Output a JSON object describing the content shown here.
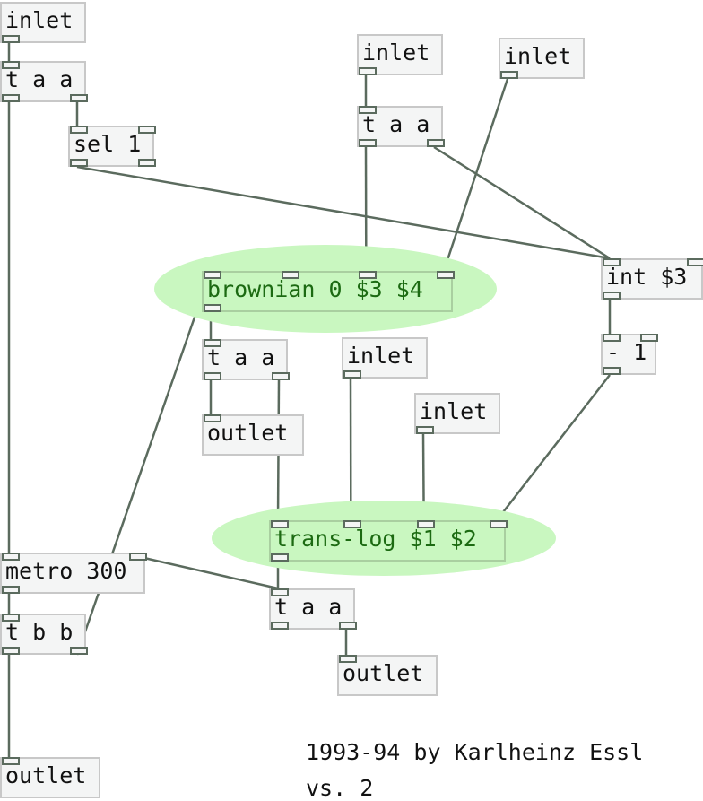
{
  "objects": [
    {
      "id": "inlet-a",
      "name": "inlet-object-1",
      "text": "inlet"
    },
    {
      "id": "taa1",
      "name": "trigger-object-1",
      "text": "t a a"
    },
    {
      "id": "sel1",
      "name": "sel-object",
      "text": "sel 1"
    },
    {
      "id": "inlet-b",
      "name": "inlet-object-2",
      "text": "inlet"
    },
    {
      "id": "inlet-c",
      "name": "inlet-object-3",
      "text": "inlet"
    },
    {
      "id": "taa2",
      "name": "trigger-object-2",
      "text": "t a a"
    },
    {
      "id": "int3",
      "name": "int-object",
      "text": "int $3"
    },
    {
      "id": "brownian",
      "name": "brownian-object",
      "text": "brownian 0 $3 $4"
    },
    {
      "id": "minus1",
      "name": "minus-object",
      "text": "- 1"
    },
    {
      "id": "taa3",
      "name": "trigger-object-3",
      "text": "t a a"
    },
    {
      "id": "inlet-d",
      "name": "inlet-object-4",
      "text": "inlet"
    },
    {
      "id": "outlet-a",
      "name": "outlet-object-1",
      "text": "outlet"
    },
    {
      "id": "inlet-e",
      "name": "inlet-object-5",
      "text": "inlet"
    },
    {
      "id": "translog",
      "name": "trans-log-object",
      "text": "trans-log $1 $2"
    },
    {
      "id": "metro",
      "name": "metro-object",
      "text": "metro 300"
    },
    {
      "id": "taa4",
      "name": "trigger-object-4",
      "text": "t a a"
    },
    {
      "id": "tbb",
      "name": "trigger-bang-object",
      "text": "t b b"
    },
    {
      "id": "outlet-b",
      "name": "outlet-object-2",
      "text": "outlet"
    },
    {
      "id": "outlet-c",
      "name": "outlet-object-3",
      "text": "outlet"
    }
  ],
  "comments": {
    "credit": "1993-94 by Karlheinz Essl",
    "version": "vs. 2"
  },
  "colors": {
    "wire": "#5b6b5e",
    "highlight": "#c9f7c0"
  }
}
